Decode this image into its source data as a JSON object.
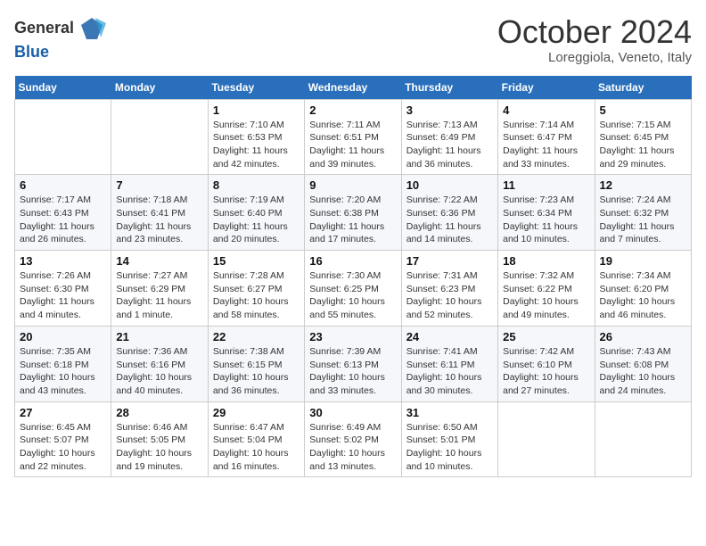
{
  "header": {
    "logo_general": "General",
    "logo_blue": "Blue",
    "month_title": "October 2024",
    "location": "Loreggiola, Veneto, Italy"
  },
  "weekdays": [
    "Sunday",
    "Monday",
    "Tuesday",
    "Wednesday",
    "Thursday",
    "Friday",
    "Saturday"
  ],
  "weeks": [
    [
      {
        "day": "",
        "info": ""
      },
      {
        "day": "",
        "info": ""
      },
      {
        "day": "1",
        "info": "Sunrise: 7:10 AM\nSunset: 6:53 PM\nDaylight: 11 hours and 42 minutes."
      },
      {
        "day": "2",
        "info": "Sunrise: 7:11 AM\nSunset: 6:51 PM\nDaylight: 11 hours and 39 minutes."
      },
      {
        "day": "3",
        "info": "Sunrise: 7:13 AM\nSunset: 6:49 PM\nDaylight: 11 hours and 36 minutes."
      },
      {
        "day": "4",
        "info": "Sunrise: 7:14 AM\nSunset: 6:47 PM\nDaylight: 11 hours and 33 minutes."
      },
      {
        "day": "5",
        "info": "Sunrise: 7:15 AM\nSunset: 6:45 PM\nDaylight: 11 hours and 29 minutes."
      }
    ],
    [
      {
        "day": "6",
        "info": "Sunrise: 7:17 AM\nSunset: 6:43 PM\nDaylight: 11 hours and 26 minutes."
      },
      {
        "day": "7",
        "info": "Sunrise: 7:18 AM\nSunset: 6:41 PM\nDaylight: 11 hours and 23 minutes."
      },
      {
        "day": "8",
        "info": "Sunrise: 7:19 AM\nSunset: 6:40 PM\nDaylight: 11 hours and 20 minutes."
      },
      {
        "day": "9",
        "info": "Sunrise: 7:20 AM\nSunset: 6:38 PM\nDaylight: 11 hours and 17 minutes."
      },
      {
        "day": "10",
        "info": "Sunrise: 7:22 AM\nSunset: 6:36 PM\nDaylight: 11 hours and 14 minutes."
      },
      {
        "day": "11",
        "info": "Sunrise: 7:23 AM\nSunset: 6:34 PM\nDaylight: 11 hours and 10 minutes."
      },
      {
        "day": "12",
        "info": "Sunrise: 7:24 AM\nSunset: 6:32 PM\nDaylight: 11 hours and 7 minutes."
      }
    ],
    [
      {
        "day": "13",
        "info": "Sunrise: 7:26 AM\nSunset: 6:30 PM\nDaylight: 11 hours and 4 minutes."
      },
      {
        "day": "14",
        "info": "Sunrise: 7:27 AM\nSunset: 6:29 PM\nDaylight: 11 hours and 1 minute."
      },
      {
        "day": "15",
        "info": "Sunrise: 7:28 AM\nSunset: 6:27 PM\nDaylight: 10 hours and 58 minutes."
      },
      {
        "day": "16",
        "info": "Sunrise: 7:30 AM\nSunset: 6:25 PM\nDaylight: 10 hours and 55 minutes."
      },
      {
        "day": "17",
        "info": "Sunrise: 7:31 AM\nSunset: 6:23 PM\nDaylight: 10 hours and 52 minutes."
      },
      {
        "day": "18",
        "info": "Sunrise: 7:32 AM\nSunset: 6:22 PM\nDaylight: 10 hours and 49 minutes."
      },
      {
        "day": "19",
        "info": "Sunrise: 7:34 AM\nSunset: 6:20 PM\nDaylight: 10 hours and 46 minutes."
      }
    ],
    [
      {
        "day": "20",
        "info": "Sunrise: 7:35 AM\nSunset: 6:18 PM\nDaylight: 10 hours and 43 minutes."
      },
      {
        "day": "21",
        "info": "Sunrise: 7:36 AM\nSunset: 6:16 PM\nDaylight: 10 hours and 40 minutes."
      },
      {
        "day": "22",
        "info": "Sunrise: 7:38 AM\nSunset: 6:15 PM\nDaylight: 10 hours and 36 minutes."
      },
      {
        "day": "23",
        "info": "Sunrise: 7:39 AM\nSunset: 6:13 PM\nDaylight: 10 hours and 33 minutes."
      },
      {
        "day": "24",
        "info": "Sunrise: 7:41 AM\nSunset: 6:11 PM\nDaylight: 10 hours and 30 minutes."
      },
      {
        "day": "25",
        "info": "Sunrise: 7:42 AM\nSunset: 6:10 PM\nDaylight: 10 hours and 27 minutes."
      },
      {
        "day": "26",
        "info": "Sunrise: 7:43 AM\nSunset: 6:08 PM\nDaylight: 10 hours and 24 minutes."
      }
    ],
    [
      {
        "day": "27",
        "info": "Sunrise: 6:45 AM\nSunset: 5:07 PM\nDaylight: 10 hours and 22 minutes."
      },
      {
        "day": "28",
        "info": "Sunrise: 6:46 AM\nSunset: 5:05 PM\nDaylight: 10 hours and 19 minutes."
      },
      {
        "day": "29",
        "info": "Sunrise: 6:47 AM\nSunset: 5:04 PM\nDaylight: 10 hours and 16 minutes."
      },
      {
        "day": "30",
        "info": "Sunrise: 6:49 AM\nSunset: 5:02 PM\nDaylight: 10 hours and 13 minutes."
      },
      {
        "day": "31",
        "info": "Sunrise: 6:50 AM\nSunset: 5:01 PM\nDaylight: 10 hours and 10 minutes."
      },
      {
        "day": "",
        "info": ""
      },
      {
        "day": "",
        "info": ""
      }
    ]
  ]
}
